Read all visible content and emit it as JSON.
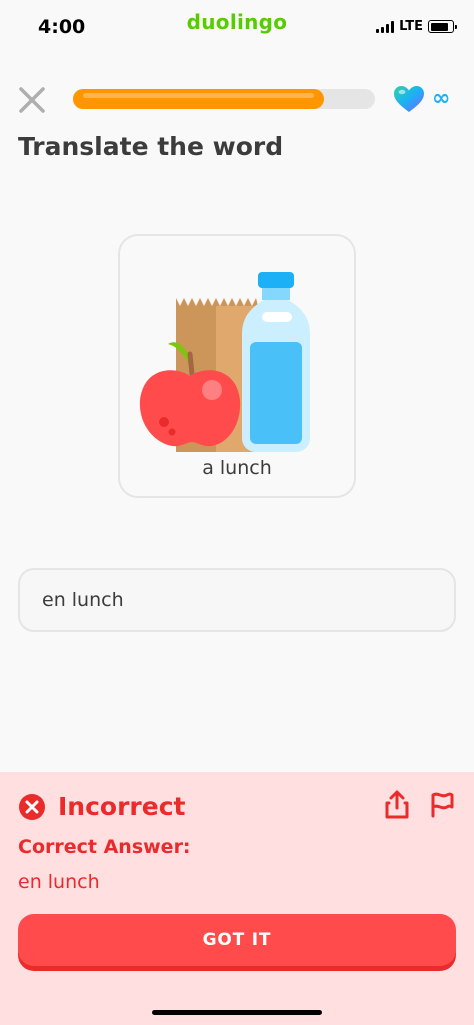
{
  "status": {
    "time": "4:00",
    "network": "LTE",
    "battery_fraction": 0.85
  },
  "app": {
    "brand": "duolingo",
    "brand_color": "#58cc02"
  },
  "lesson": {
    "progress_fraction": 0.83,
    "hearts": "∞",
    "prompt": "Translate the word",
    "card_word": "a lunch",
    "answer_value": "en lunch"
  },
  "feedback": {
    "title": "Incorrect",
    "label": "Correct Answer:",
    "answer": "en lunch",
    "button_label": "GOT IT",
    "color": "#ea2b2b",
    "background": "#ffdfe0"
  },
  "icons": [
    "close-icon",
    "heart-icon",
    "infinity-icon",
    "x-circle-icon",
    "share-icon",
    "flag-icon"
  ]
}
